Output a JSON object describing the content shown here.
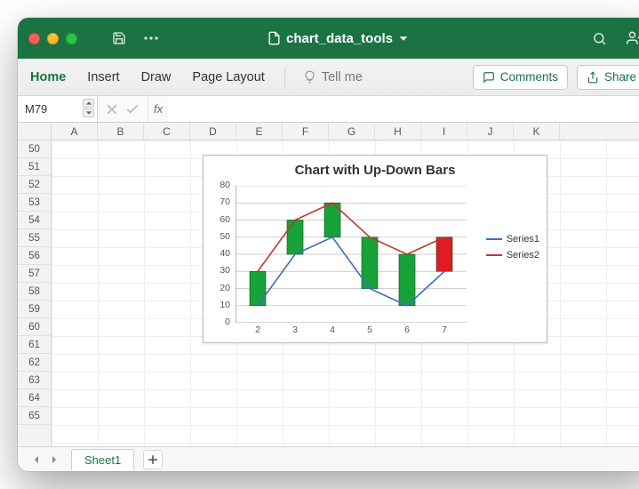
{
  "window": {
    "title": "chart_data_tools"
  },
  "ribbon": {
    "tabs": {
      "home": "Home",
      "insert": "Insert",
      "draw": "Draw",
      "page_layout": "Page Layout"
    },
    "tellme": "Tell me",
    "comments": "Comments",
    "share": "Share"
  },
  "formula": {
    "namebox": "M79",
    "fx": "fx"
  },
  "columns": [
    "A",
    "B",
    "C",
    "D",
    "E",
    "F",
    "G",
    "H",
    "I",
    "J",
    "K"
  ],
  "rows": [
    "50",
    "51",
    "52",
    "53",
    "54",
    "55",
    "56",
    "57",
    "58",
    "59",
    "60",
    "61",
    "62",
    "63",
    "64",
    "65"
  ],
  "sheets": {
    "active": "Sheet1"
  },
  "legend": {
    "s1": "Series1",
    "s2": "Series2"
  },
  "colors": {
    "s1": "#3d6fb5",
    "s2": "#c0392b",
    "up": "#18a23a",
    "down": "#e01b24"
  },
  "chart_data": {
    "type": "line",
    "title": "Chart with Up-Down Bars",
    "xlabel": "",
    "ylabel": "",
    "ylim": [
      0,
      80
    ],
    "grid": true,
    "legend_position": "right",
    "categories": [
      "2",
      "3",
      "4",
      "5",
      "6",
      "7"
    ],
    "series": [
      {
        "name": "Series1",
        "values": [
          10,
          40,
          50,
          20,
          10,
          30
        ]
      },
      {
        "name": "Series2",
        "values": [
          30,
          60,
          70,
          50,
          40,
          50
        ]
      }
    ],
    "updown_bars": [
      {
        "x": "2",
        "low": 10,
        "high": 30,
        "dir": "up"
      },
      {
        "x": "3",
        "low": 40,
        "high": 60,
        "dir": "up"
      },
      {
        "x": "4",
        "low": 50,
        "high": 70,
        "dir": "up"
      },
      {
        "x": "5",
        "low": 20,
        "high": 50,
        "dir": "up"
      },
      {
        "x": "6",
        "low": 10,
        "high": 40,
        "dir": "up"
      },
      {
        "x": "7",
        "low": 30,
        "high": 50,
        "dir": "down"
      }
    ]
  }
}
